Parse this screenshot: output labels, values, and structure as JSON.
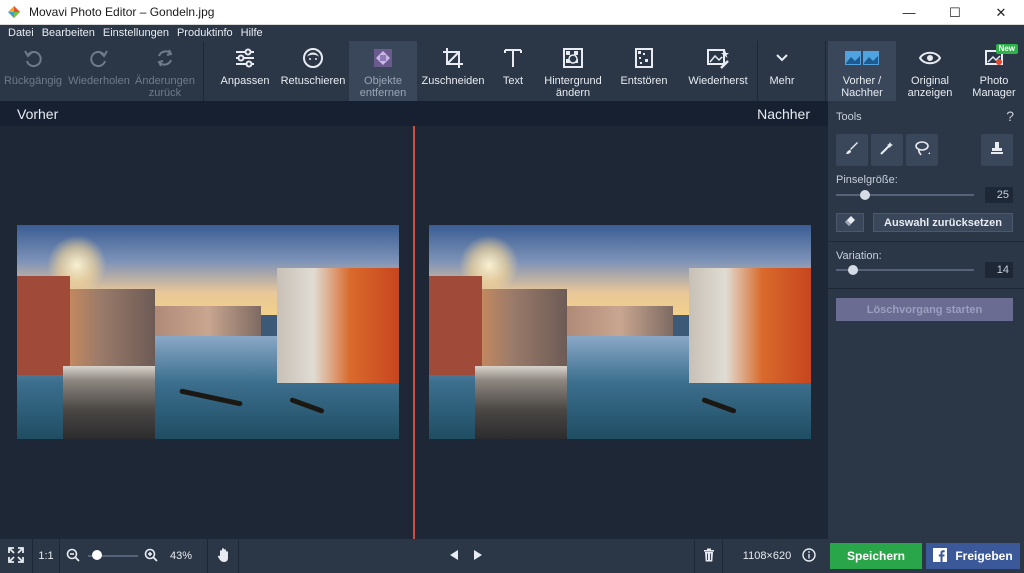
{
  "window": {
    "title": "Movavi Photo Editor – Gondeln.jpg",
    "controls": [
      "—",
      "☐",
      "✕"
    ]
  },
  "menu": [
    "Datei",
    "Bearbeiten",
    "Einstellungen",
    "Produktinfo",
    "Hilfe"
  ],
  "toolbar": {
    "undo": "Rückgängig",
    "redo": "Wiederholen",
    "revert": "Änderungen\nzurück",
    "adjust": "Anpassen",
    "retouch": "Retuschieren",
    "remove_objects": "Objekte\nentfernen",
    "crop": "Zuschneiden",
    "text": "Text",
    "change_background": "Hintergrund\nändern",
    "denoise": "Entstören",
    "restore": "Wiederherst",
    "more": "Mehr",
    "before_after": "Vorher /\nNachher",
    "show_original": "Original\nanzeigen",
    "photo_manager": "Photo\nManager",
    "new_badge": "New"
  },
  "compare": {
    "before": "Vorher",
    "after": "Nachher"
  },
  "panel": {
    "tools_title": "Tools",
    "help": "?",
    "brush_size_label": "Pinselgröße:",
    "brush_size_value": "25",
    "brush_size_level": 0.19,
    "reset_selection": "Auswahl zurücksetzen",
    "variation_label": "Variation:",
    "variation_value": "14",
    "variation_level": 0.09,
    "start_erase": "Löschvorgang starten"
  },
  "bottom": {
    "ratio": "1:1",
    "zoom": "43%",
    "zoom_level": 0.1,
    "dimensions": "1108×620",
    "save": "Speichern",
    "share": "Freigeben"
  },
  "colors": {
    "background": "#1e2736",
    "toolbar": "#2b3646",
    "accent_divider": "#e0492f",
    "save": "#2aa64a",
    "share": "#3b5898"
  }
}
